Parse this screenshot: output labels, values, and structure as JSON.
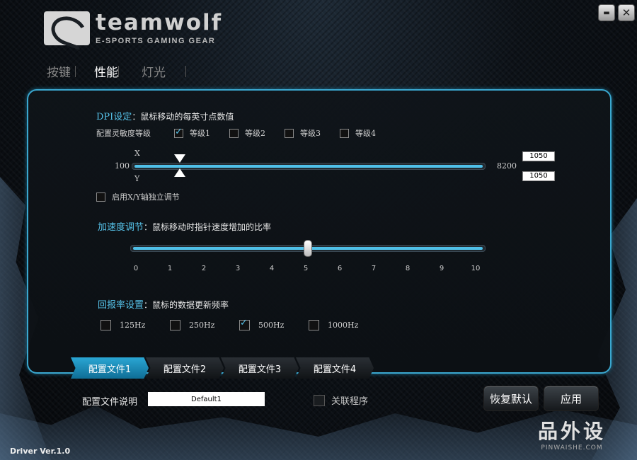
{
  "brand": {
    "name": "teamwolf",
    "tagline": "E-SPORTS GAMING GEAR"
  },
  "window": {
    "minimize": "▬",
    "close": "✕"
  },
  "top_tabs": [
    {
      "label": "按键",
      "active": false
    },
    {
      "label": "性能",
      "active": true
    },
    {
      "label": "灯光",
      "active": false
    }
  ],
  "dpi": {
    "title": "DPI设定",
    "desc": "：鼠标移动的每英寸点数值",
    "levels_label": "配置灵敏度等级",
    "levels": [
      {
        "label": "等级1",
        "checked": true
      },
      {
        "label": "等级2",
        "checked": false
      },
      {
        "label": "等级3",
        "checked": false
      },
      {
        "label": "等级4",
        "checked": false
      }
    ],
    "x_label": "X",
    "y_label": "Y",
    "min": "100",
    "max": "8200",
    "x_value": "1050",
    "y_value": "1050",
    "xy_independent": "启用X/Y轴独立调节"
  },
  "accel": {
    "title": "加速度调节",
    "desc": "：鼠标移动时指针速度增加的比率",
    "ticks": [
      "0",
      "1",
      "2",
      "3",
      "4",
      "5",
      "6",
      "7",
      "8",
      "9",
      "10"
    ],
    "value": 5
  },
  "report": {
    "title": "回报率设置",
    "desc": "：鼠标的数据更新频率",
    "options": [
      {
        "label": "125Hz",
        "checked": false
      },
      {
        "label": "250Hz",
        "checked": false
      },
      {
        "label": "500Hz",
        "checked": true
      },
      {
        "label": "1000Hz",
        "checked": false
      }
    ]
  },
  "profiles": [
    {
      "label": "配置文件1",
      "active": true
    },
    {
      "label": "配置文件2",
      "active": false
    },
    {
      "label": "配置文件3",
      "active": false
    },
    {
      "label": "配置文件4",
      "active": false
    }
  ],
  "profile_desc_label": "配置文件说明",
  "profile_desc_value": "Default1",
  "assoc_label": "关联程序",
  "buttons": {
    "restore": "恢复默认",
    "apply": "应用"
  },
  "version": "Driver Ver.1.0",
  "watermark": {
    "big": "品外设",
    "small": "PINWAISHE.COM"
  }
}
